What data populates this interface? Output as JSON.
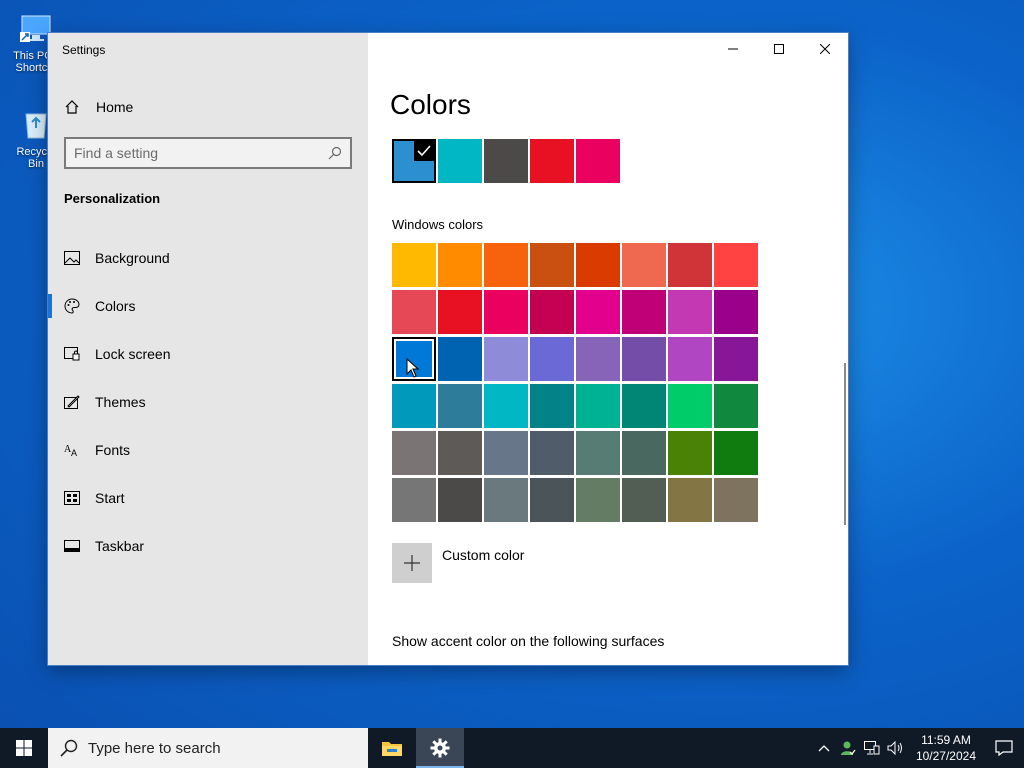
{
  "desktop": {
    "icons": [
      {
        "label": "This PC - Shortcut",
        "icon": "this-pc-icon"
      },
      {
        "label": "Recycle Bin",
        "icon": "recycle-bin-icon"
      }
    ]
  },
  "window": {
    "title": "Settings",
    "controls": {
      "minimize": "minimize-icon",
      "maximize": "maximize-icon",
      "close": "close-icon"
    }
  },
  "sidebar": {
    "home_label": "Home",
    "search_placeholder": "Find a setting",
    "section_title": "Personalization",
    "items": [
      {
        "label": "Background",
        "icon": "background-icon"
      },
      {
        "label": "Colors",
        "icon": "palette-icon",
        "active": true
      },
      {
        "label": "Lock screen",
        "icon": "lock-screen-icon"
      },
      {
        "label": "Themes",
        "icon": "themes-icon"
      },
      {
        "label": "Fonts",
        "icon": "fonts-icon"
      },
      {
        "label": "Start",
        "icon": "start-icon"
      },
      {
        "label": "Taskbar",
        "icon": "taskbar-icon"
      }
    ]
  },
  "main": {
    "title": "Colors",
    "recent_colors": [
      "#2b8fd0",
      "#00b7c3",
      "#4c4a48",
      "#e81123",
      "#ea005e"
    ],
    "recent_selected_index": 0,
    "windows_colors_label": "Windows colors",
    "windows_colors": [
      [
        "#ffb900",
        "#ff8c00",
        "#f7630c",
        "#ca5010",
        "#da3b01",
        "#ef6950",
        "#d13438",
        "#ff4343"
      ],
      [
        "#e74856",
        "#e81123",
        "#ea005e",
        "#c30052",
        "#e3008c",
        "#bf0077",
        "#c239b3",
        "#9a0089"
      ],
      [
        "#0078d7",
        "#0063b1",
        "#8e8cd8",
        "#6b69d6",
        "#8764b8",
        "#744da9",
        "#b146c2",
        "#881798"
      ],
      [
        "#0099bc",
        "#2d7d9a",
        "#00b7c3",
        "#038387",
        "#00b294",
        "#018574",
        "#00cc6a",
        "#10893e"
      ],
      [
        "#7a7574",
        "#5d5a58",
        "#68768a",
        "#515c6b",
        "#567c73",
        "#486860",
        "#498205",
        "#107c10"
      ],
      [
        "#767676",
        "#4c4a48",
        "#69797e",
        "#4a5459",
        "#647c64",
        "#525e54",
        "#847545",
        "#7e735f"
      ]
    ],
    "selected_cell": {
      "row": 2,
      "col": 0
    },
    "custom_color_label": "Custom color",
    "surfaces_label": "Show accent color on the following surfaces"
  },
  "taskbar": {
    "search_placeholder": "Type here to search",
    "apps": [
      {
        "name": "File Explorer",
        "icon": "file-explorer-icon",
        "active": false
      },
      {
        "name": "Settings",
        "icon": "settings-gear-icon",
        "active": true
      }
    ],
    "tray_icons": [
      "chevron-up-icon",
      "people-icon",
      "network-icon",
      "volume-icon"
    ],
    "time": "11:59 AM",
    "date": "10/27/2024"
  }
}
